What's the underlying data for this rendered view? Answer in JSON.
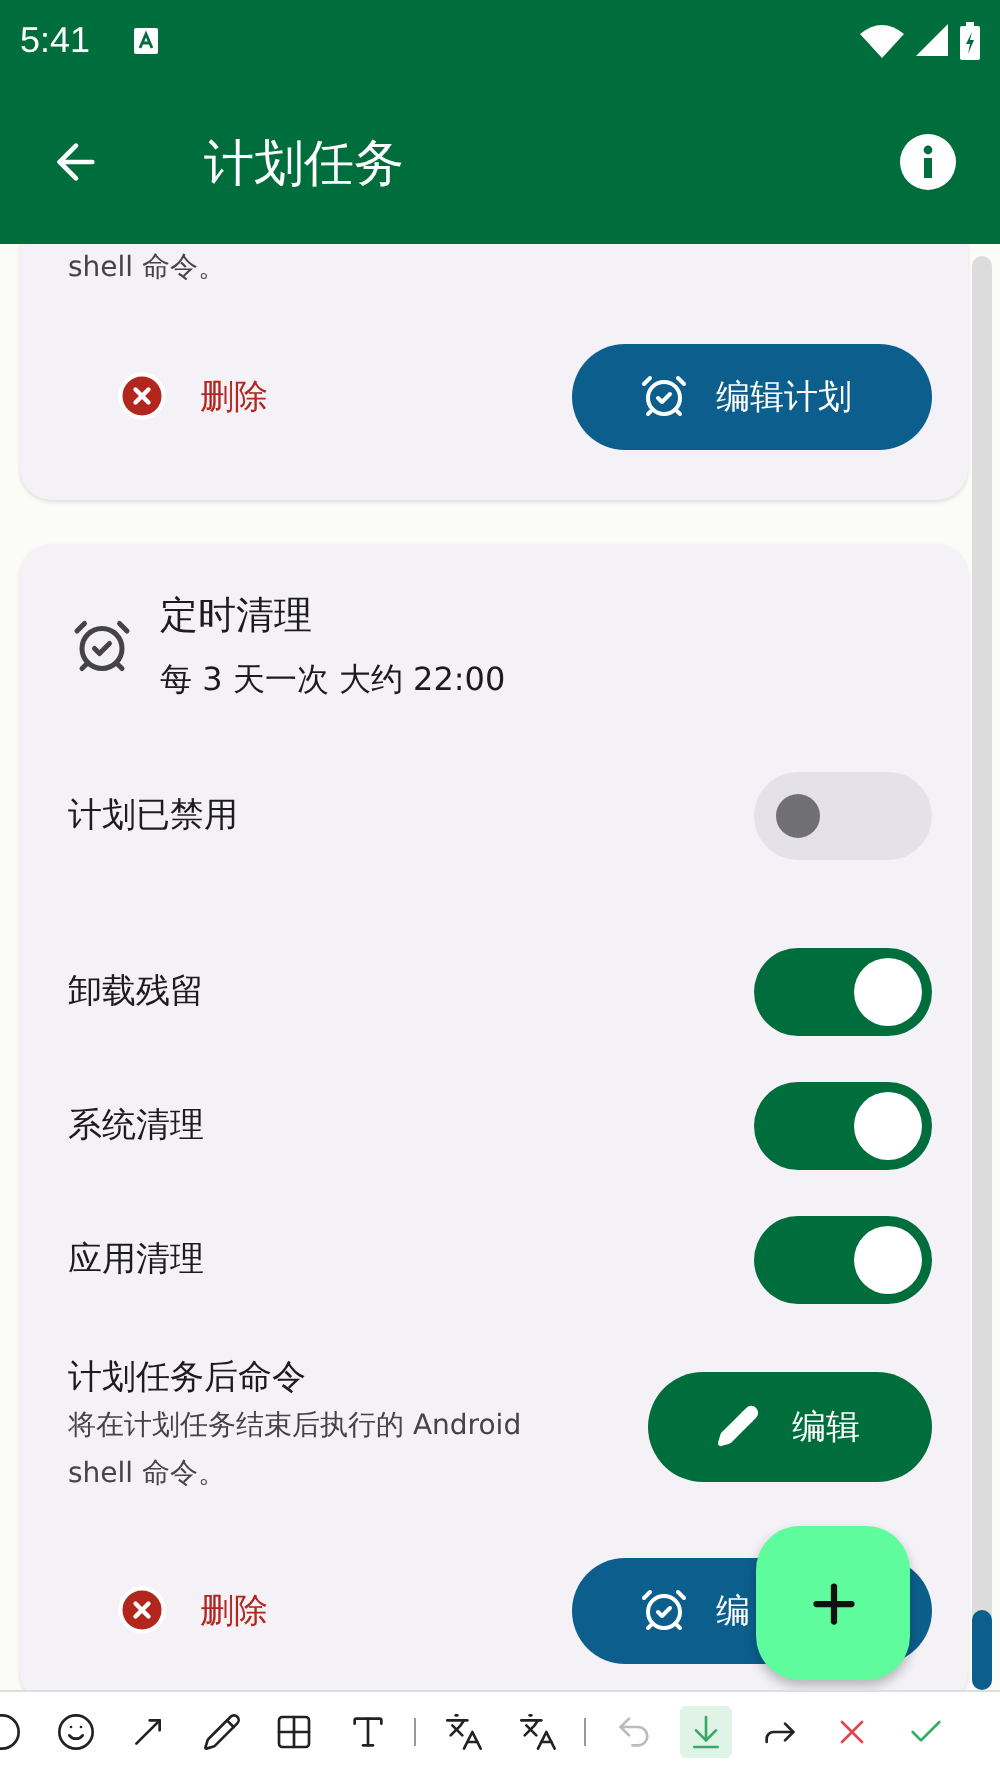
{
  "status_bar": {
    "time": "5:41"
  },
  "app_bar": {
    "title": "计划任务"
  },
  "cards": [
    {
      "kind": "partial",
      "description_tail": "shell 命令。",
      "delete_label": "删除",
      "edit_plan_label": "编辑计划"
    },
    {
      "kind": "full",
      "title": "定时清理",
      "schedule": "每 3 天一次 大约 22:00",
      "disabled_toggle": {
        "label": "计划已禁用",
        "on": false
      },
      "options": [
        {
          "label": "卸载残留",
          "on": true
        },
        {
          "label": "系统清理",
          "on": true
        },
        {
          "label": "应用清理",
          "on": true
        }
      ],
      "command": {
        "title": "计划任务后命令",
        "description": "将在计划任务结束后执行的 Android shell 命令。",
        "edit_label": "编辑"
      },
      "delete_label": "删除",
      "edit_plan_label": "编"
    }
  ],
  "toolbar": {
    "tools": [
      {
        "kind": "circle"
      },
      {
        "kind": "emoji"
      },
      {
        "kind": "arrow"
      },
      {
        "kind": "pen"
      },
      {
        "kind": "mosaic"
      },
      {
        "kind": "textbox"
      },
      {
        "kind": "divider"
      },
      {
        "kind": "translate"
      },
      {
        "kind": "translate-box"
      },
      {
        "kind": "divider"
      },
      {
        "kind": "undo",
        "disabled": true
      },
      {
        "kind": "save",
        "selected": true
      },
      {
        "kind": "share"
      },
      {
        "kind": "cancel"
      },
      {
        "kind": "confirm"
      }
    ]
  }
}
